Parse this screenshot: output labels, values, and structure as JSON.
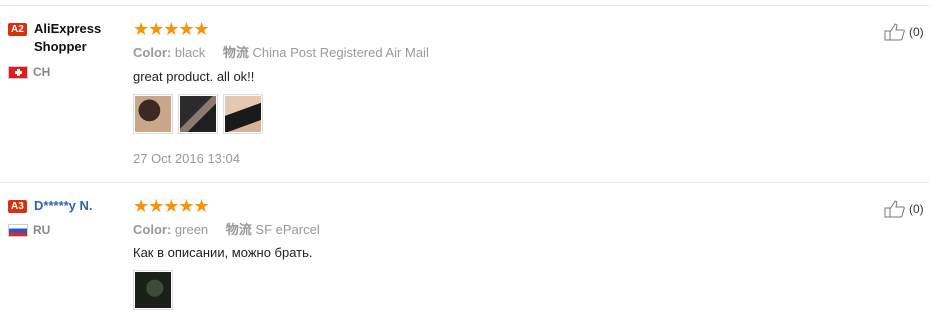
{
  "reviews": [
    {
      "level": "A2",
      "name": "AliExpress Shopper",
      "country": "CH",
      "stars": "★★★★★",
      "color_label": "Color:",
      "color_value": "black",
      "shipping_label": "物流",
      "shipping_value": "China Post Registered Air Mail",
      "text": "great product. all ok!!",
      "date": "27 Oct 2016 13:04",
      "helpful_count": "(0)"
    },
    {
      "level": "A3",
      "name": "D*****y N.",
      "country": "RU",
      "stars": "★★★★★",
      "color_label": "Color:",
      "color_value": "green",
      "shipping_label": "物流",
      "shipping_value": "SF eParcel",
      "text": "Как в описании, можно брать.",
      "helpful_count": "(0)"
    }
  ],
  "icons": {
    "thumb_up": "thumb-up-icon",
    "flag_ch": "swiss-flag-icon",
    "flag_ru": "russia-flag-icon"
  },
  "colors": {
    "star": "#f79309",
    "level_badge": "#d9310f",
    "link_name": "#2f62b8"
  }
}
